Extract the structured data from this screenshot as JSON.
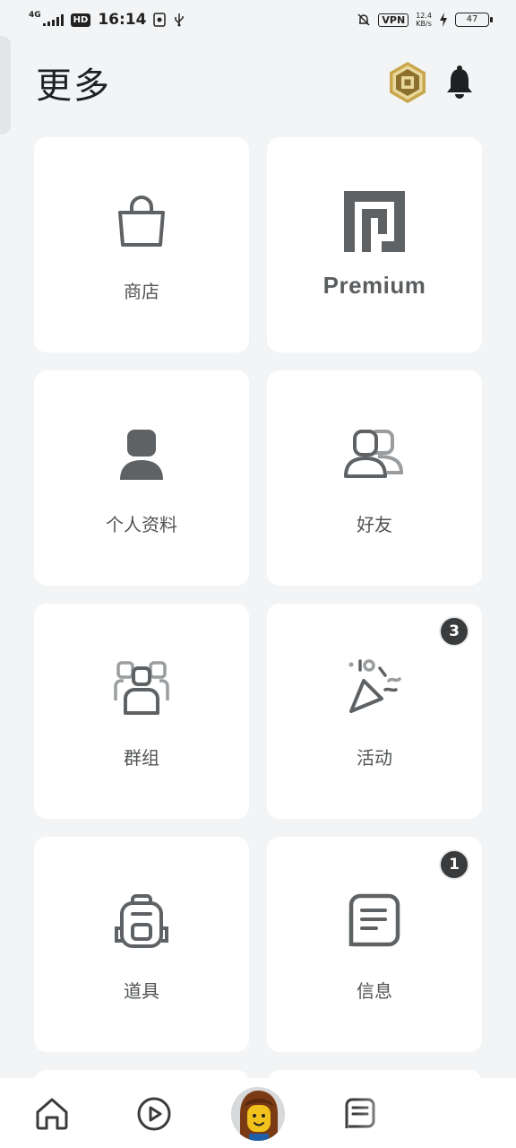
{
  "status_bar": {
    "network": "4G",
    "hd": "HD",
    "time": "16:14",
    "vpn": "VPN",
    "speed_value": "12.4",
    "speed_unit": "KB/s",
    "battery": "47"
  },
  "header": {
    "title": "更多"
  },
  "tiles": [
    {
      "label": "商店",
      "icon": "shopping-bag-icon"
    },
    {
      "label": "Premium",
      "icon": "premium-icon"
    },
    {
      "label": "个人资料",
      "icon": "profile-icon"
    },
    {
      "label": "好友",
      "icon": "friends-icon"
    },
    {
      "label": "群组",
      "icon": "groups-icon"
    },
    {
      "label": "活动",
      "icon": "party-popper-icon",
      "badge": "3"
    },
    {
      "label": "道具",
      "icon": "backpack-icon"
    },
    {
      "label": "信息",
      "icon": "message-icon",
      "badge": "1"
    }
  ],
  "bottom_nav": {
    "items": [
      "home-icon",
      "play-icon",
      "avatar",
      "chat-icon"
    ]
  },
  "colors": {
    "background": "#f2f4f5",
    "tile": "#ffffff",
    "icon": "#5f6265",
    "badge": "#393b3d",
    "robux_gold": "#c9a64b"
  }
}
